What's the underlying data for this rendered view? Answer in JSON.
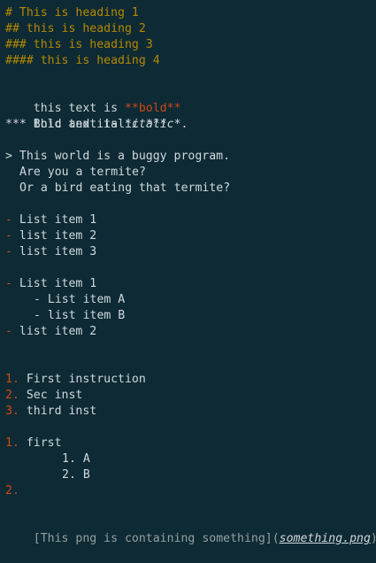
{
  "headings": {
    "h1": "# This is heading 1",
    "h2": "## this is heading 2",
    "h3": "### this is heading 3",
    "h4": "#### this is heading 4"
  },
  "emphasis": {
    "bold_prefix": "this text is ",
    "bold_text": "**bold**",
    "italic_prefix": "thic text is ",
    "italic_open": "*",
    "italic_text": "italic",
    "italic_close": "*.",
    "bold_italic": "*** Bold and italic ***"
  },
  "blockquote": {
    "line1": "> This world is a buggy program.",
    "line2": "Are you a termite?",
    "line3": "Or a bird eating that termite?"
  },
  "list1": {
    "marker": "-",
    "items": [
      " List item 1",
      " list item 2",
      " list item 3"
    ]
  },
  "list2": {
    "marker": "-",
    "item1": " List item 1",
    "sub_a": "- List item A",
    "sub_b": "- list item B",
    "item2": " list item 2"
  },
  "ordered1": {
    "markers": [
      "1.",
      "2.",
      "3."
    ],
    "items": [
      " First instruction",
      " Sec inst",
      " third inst"
    ]
  },
  "ordered2": {
    "marker1": "1.",
    "item1": " first",
    "sub1": "1. A",
    "sub2": "2. B",
    "marker2": "2."
  },
  "link": {
    "text": "[This png is containing something]",
    "open_paren": "(",
    "url": "something.png",
    "close_paren": ")"
  }
}
